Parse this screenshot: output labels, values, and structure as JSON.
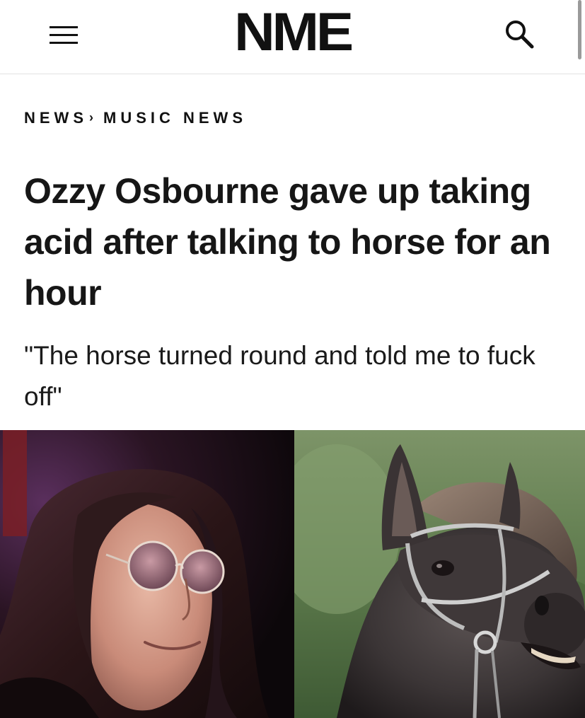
{
  "header": {
    "logo_text": "NME",
    "menu_icon": "hamburger-menu-icon",
    "search_icon": "search-icon"
  },
  "breadcrumb": {
    "section": "NEWS",
    "separator": "›",
    "subsection": "MUSIC NEWS"
  },
  "article": {
    "headline": "Ozzy Osbourne gave up taking acid after talking to horse for an hour",
    "standfirst": "\"The horse turned round and told me to fuck off\""
  },
  "hero_image": {
    "left_subject": "man with long dark hair wearing round tinted glasses",
    "right_subject": "dark horse wearing a bridle",
    "colors": {
      "left_background": "#1a0d14",
      "right_background": "#5d7a4c",
      "horse_coat": "#3b3536"
    }
  }
}
